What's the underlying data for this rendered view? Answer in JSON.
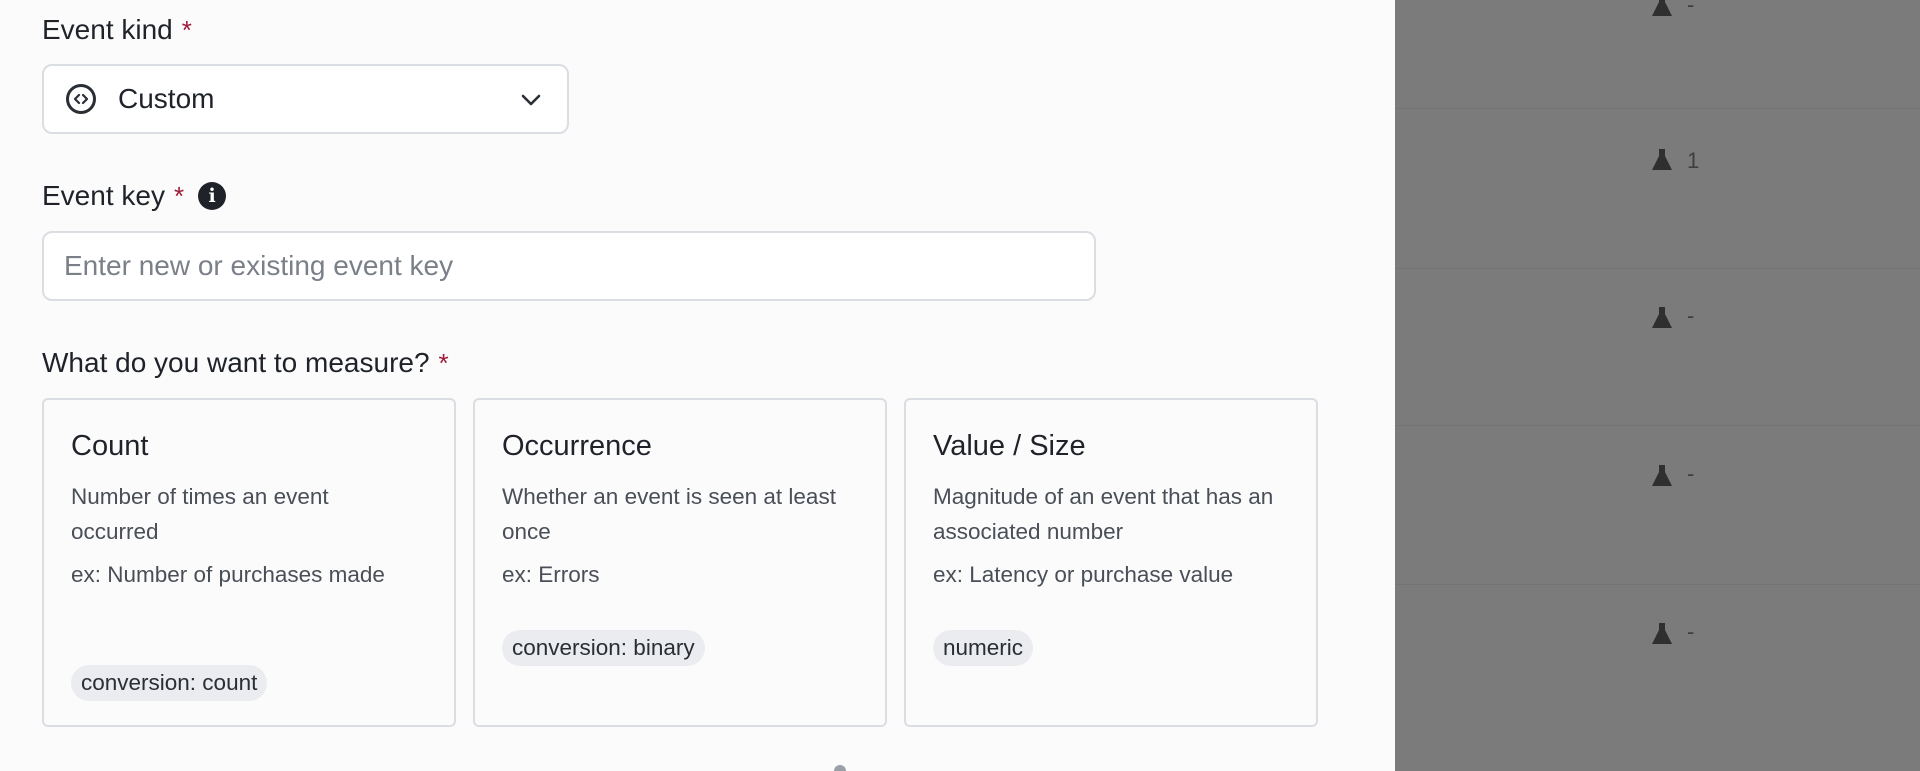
{
  "form": {
    "event_kind": {
      "label": "Event kind",
      "required_mark": "*",
      "selected_value": "Custom",
      "icon": "code-circle-icon"
    },
    "event_key": {
      "label": "Event key",
      "required_mark": "*",
      "info_glyph": "i",
      "placeholder": "Enter new or existing event key",
      "value": ""
    },
    "measure": {
      "label": "What do you want to measure?",
      "required_mark": "*",
      "options": [
        {
          "title": "Count",
          "description": "Number of times an event occurred",
          "example": "ex: Number of purchases made",
          "badge": "conversion: count"
        },
        {
          "title": "Occurrence",
          "description": "Whether an event is seen at least once",
          "example": "ex: Errors",
          "badge": "conversion: binary"
        },
        {
          "title": "Value / Size",
          "description": "Magnitude of an event that has an associated number",
          "example": "ex: Latency or purchase value",
          "badge": "numeric"
        }
      ]
    }
  },
  "background_table": {
    "rows": [
      {
        "icon": "flask-icon",
        "value": "-"
      },
      {
        "icon": "flask-icon",
        "value": "1"
      },
      {
        "icon": "flask-icon",
        "value": "-"
      },
      {
        "icon": "flask-icon",
        "value": "-"
      },
      {
        "icon": "flask-icon",
        "value": "-"
      }
    ]
  },
  "colors": {
    "required": "#9b1b3b",
    "overlay": "#7b7b7b",
    "border": "#dadde2"
  }
}
